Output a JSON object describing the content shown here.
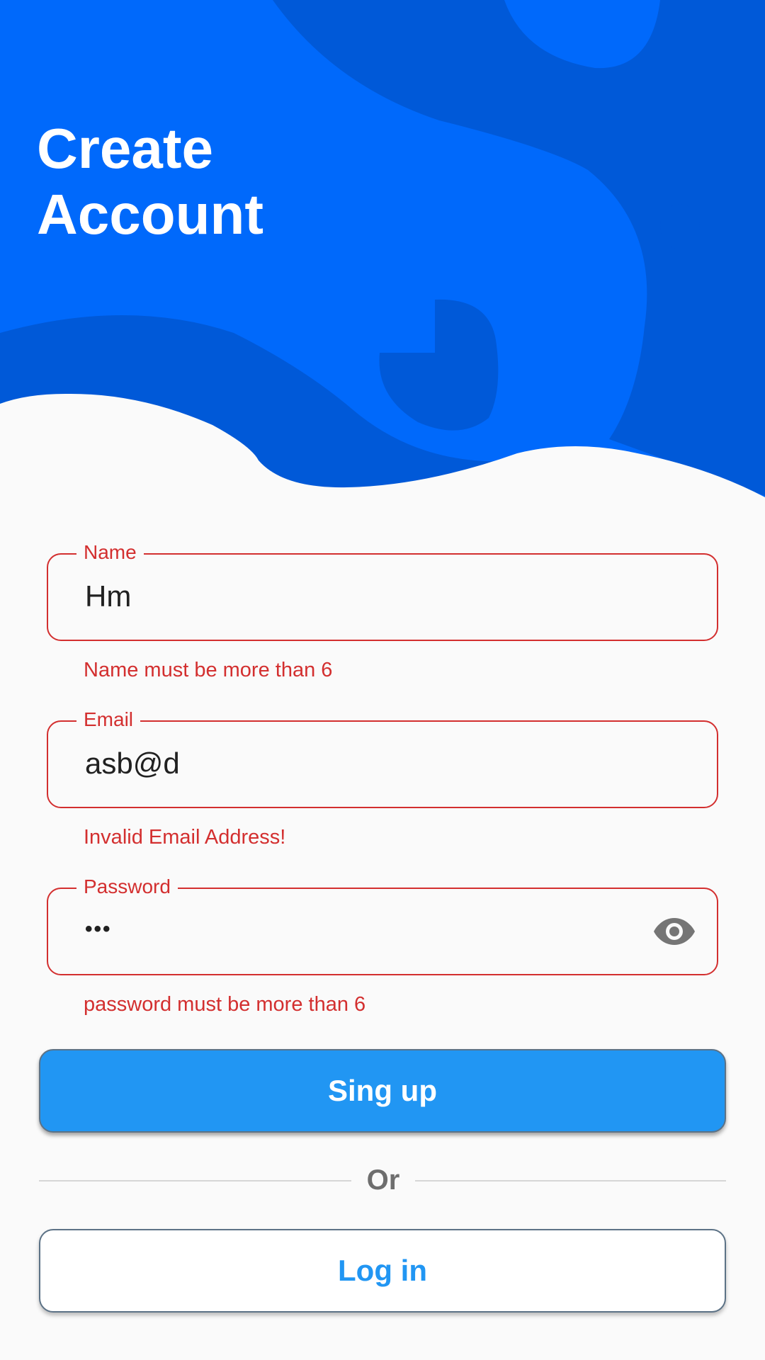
{
  "header": {
    "title_line1": "Create",
    "title_line2": "Account"
  },
  "form": {
    "name": {
      "label": "Name",
      "value": "Hm",
      "error": "Name must be more than 6"
    },
    "email": {
      "label": "Email",
      "value": "asb@d",
      "error": "Invalid Email Address!"
    },
    "password": {
      "label": "Password",
      "value": "•••",
      "error": "password must be more than 6",
      "visibility_icon": "eye-icon"
    }
  },
  "actions": {
    "signup_label": "Sing up",
    "divider_label": "Or",
    "login_label": "Log in"
  },
  "colors": {
    "header_blue": "#0069fb",
    "header_dark_blue": "#0059d8",
    "error_red": "#d32f2f",
    "button_blue": "#2196f3",
    "background": "#fafafa"
  }
}
